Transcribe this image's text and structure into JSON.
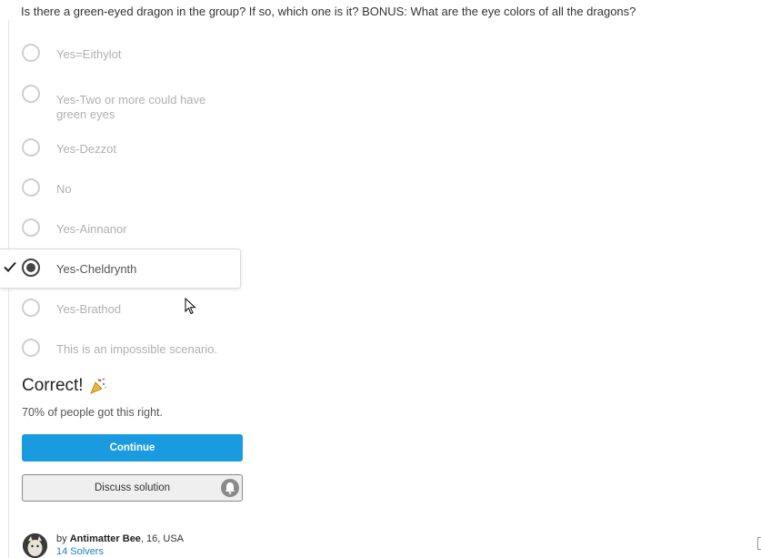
{
  "question": "Is there a green-eyed dragon in the group? If so, which one is it? BONUS: What are the eye colors of all the dragons?",
  "options": [
    {
      "label": "Yes=Eithylot",
      "selected": false
    },
    {
      "label": "Yes-Two or more could have green eyes",
      "selected": false
    },
    {
      "label": "Yes-Dezzot",
      "selected": false
    },
    {
      "label": "No",
      "selected": false
    },
    {
      "label": "Yes-Ainnanor",
      "selected": false
    },
    {
      "label": "Yes-Cheldrynth",
      "selected": true
    },
    {
      "label": "Yes-Brathod",
      "selected": false
    },
    {
      "label": "This is an impossible scenario.",
      "selected": false
    }
  ],
  "result": {
    "title": "Correct!",
    "stat": "70% of people got this right."
  },
  "buttons": {
    "continue": "Continue",
    "discuss": "Discuss solution"
  },
  "author": {
    "by": "by",
    "name": "Antimatter Bee",
    "details": ", 16, USA",
    "solvers": "14 Solvers"
  },
  "colors": {
    "primary": "#1a9bdf",
    "link": "#1a7fc1"
  }
}
